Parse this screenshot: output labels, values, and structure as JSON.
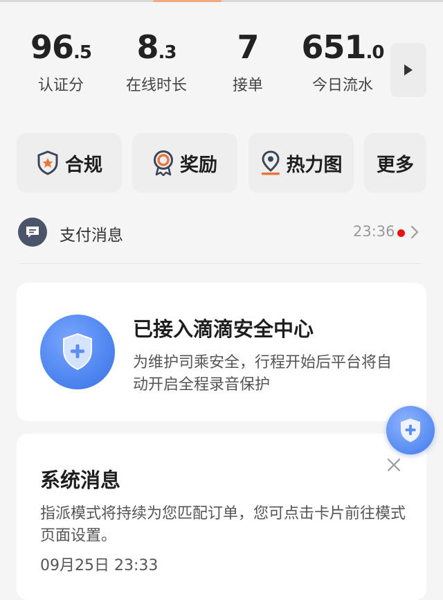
{
  "stats": [
    {
      "int": "96",
      "dec": ".5",
      "label": "认证分"
    },
    {
      "int": "8",
      "dec": ".3",
      "label": "在线时长"
    },
    {
      "int": "7",
      "dec": "",
      "label": "接单"
    },
    {
      "int": "651",
      "dec": ".0",
      "label": "今日流水"
    }
  ],
  "quick_actions": {
    "compliance": "合规",
    "reward": "奖励",
    "heatmap": "热力图",
    "more": "更多"
  },
  "payment_message": {
    "title": "支付消息",
    "time": "23:36"
  },
  "safety_card": {
    "title": "已接入滴滴安全中心",
    "description": "为维护司乘安全，行程开始后平台将自动开启全程录音保护"
  },
  "system_message": {
    "title": "系统消息",
    "body": "指派模式将持续为您匹配订单，您可点击卡片前往模式页面设置。",
    "time": "09月25日 23:33"
  },
  "colors": {
    "accent_orange": "#e8763a",
    "shield_blue": "#4f86f0",
    "unread_dot": "#e81414",
    "avatar_bg": "#4b5468"
  },
  "icons": [
    "play-arrow-icon",
    "shield-star-icon",
    "medal-icon",
    "location-pin-icon",
    "chat-bubble-icon",
    "chevron-right-icon",
    "shield-plus-icon",
    "close-icon"
  ]
}
